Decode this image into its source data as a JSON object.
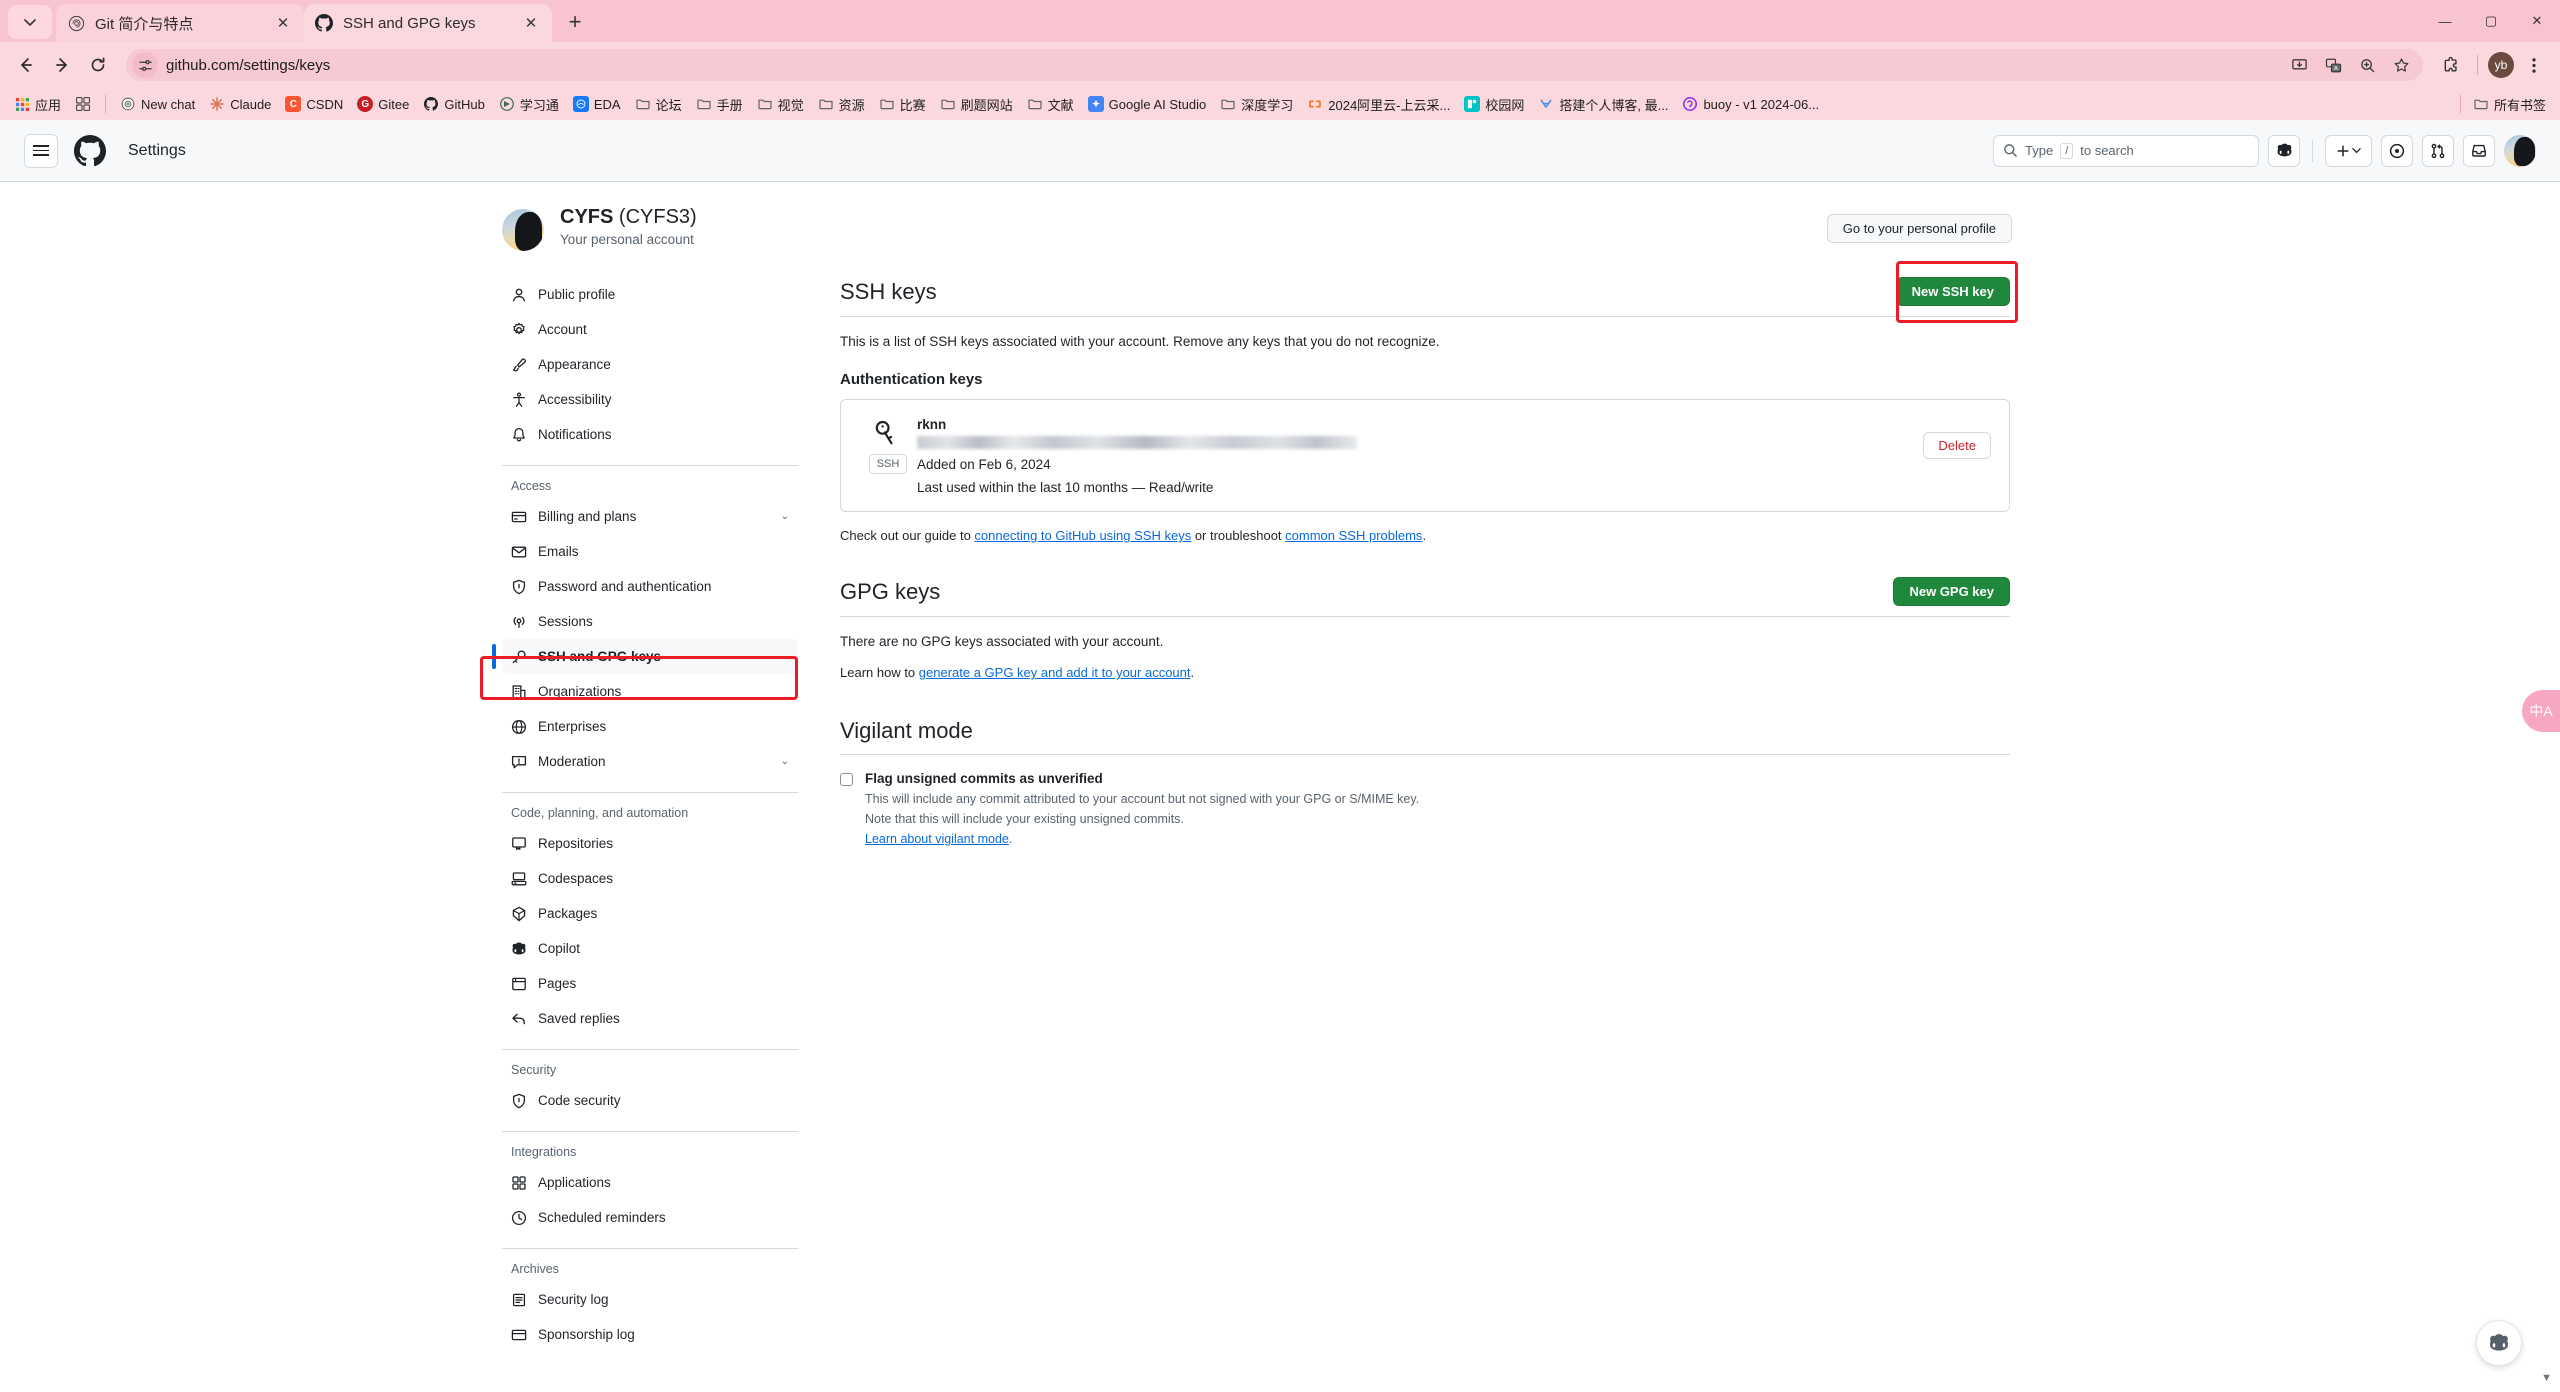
{
  "browser": {
    "tabs": [
      {
        "title": "Git 简介与特点",
        "favicon": "openai-icon",
        "active": false
      },
      {
        "title": "SSH and GPG keys",
        "favicon": "github-icon",
        "active": true
      }
    ],
    "new_tab_label": "+",
    "tab_list_icon": "chevron-down-icon",
    "window_controls": {
      "minimize": "—",
      "maximize": "▢",
      "close": "✕"
    },
    "nav": {
      "back": "←",
      "forward": "→",
      "reload": "⟳"
    },
    "omnibox": {
      "url": "github.com/settings/keys",
      "url_host": "github.com",
      "url_path": "/settings/keys",
      "site_icon": "site-settings-icon"
    },
    "toolbar_icons": [
      "install-app-icon",
      "translate-icon",
      "zoom-icon",
      "bookmark-star-icon",
      "extensions-icon"
    ],
    "profile_chip": "yb",
    "menu_icon": "kebab-menu-icon",
    "bookmarks": [
      {
        "label": "应用",
        "icon": "apps-grid-icon",
        "color": "#ffffff"
      },
      {
        "label": "",
        "icon": "bookmark-group-icon",
        "color": "#5f6368"
      },
      {
        "label": "New chat",
        "icon": "openai-icon",
        "color": "#ffffff"
      },
      {
        "label": "Claude",
        "icon": "claude-icon",
        "color": "#d97757"
      },
      {
        "label": "CSDN",
        "icon": "csdn-icon",
        "color": "#fc5531"
      },
      {
        "label": "Gitee",
        "icon": "gitee-icon",
        "color": "#c71d23"
      },
      {
        "label": "GitHub",
        "icon": "github-icon",
        "color": "#1f2328"
      },
      {
        "label": "学习通",
        "icon": "chaoxing-icon",
        "color": "#4a7a4a"
      },
      {
        "label": "EDA",
        "icon": "eda-icon",
        "color": "#1677ff"
      },
      {
        "label": "论坛",
        "icon": "folder-icon",
        "color": "#5f6368"
      },
      {
        "label": "手册",
        "icon": "folder-icon",
        "color": "#5f6368"
      },
      {
        "label": "视觉",
        "icon": "folder-icon",
        "color": "#5f6368"
      },
      {
        "label": "资源",
        "icon": "folder-icon",
        "color": "#5f6368"
      },
      {
        "label": "比赛",
        "icon": "folder-icon",
        "color": "#5f6368"
      },
      {
        "label": "刷题网站",
        "icon": "folder-icon",
        "color": "#5f6368"
      },
      {
        "label": "文献",
        "icon": "folder-icon",
        "color": "#5f6368"
      },
      {
        "label": "Google AI Studio",
        "icon": "google-ai-icon",
        "color": "#4285f4"
      },
      {
        "label": "深度学习",
        "icon": "folder-icon",
        "color": "#5f6368"
      },
      {
        "label": "2024阿里云-上云采...",
        "icon": "aliyun-icon",
        "color": "#ff6a00"
      },
      {
        "label": "校园网",
        "icon": "campus-net-icon",
        "color": "#00c2c7"
      },
      {
        "label": "搭建个人博客, 最...",
        "icon": "blog-icon",
        "color": "#4a90e2"
      },
      {
        "label": "buoy - v1 2024-06...",
        "icon": "buoy-icon",
        "color": "#8b2fe0"
      }
    ],
    "all_bookmarks": {
      "label": "所有书签",
      "icon": "folder-icon"
    }
  },
  "github": {
    "header": {
      "menu_icon": "hamburger-icon",
      "logo_icon": "github-mark-icon",
      "title": "Settings",
      "search_placeholder": "Type",
      "search_key": "/",
      "search_suffix": "to search",
      "copilot_icon": "copilot-icon",
      "create_new_icon": "plus-icon",
      "create_new_caret": "chevron-down-icon",
      "issues_icon": "issue-opened-icon",
      "pull_requests_icon": "git-pull-request-icon",
      "notifications_icon": "inbox-icon",
      "avatar": "user-avatar"
    },
    "profile": {
      "name": "CYFS",
      "handle": "(CYFS3)",
      "subtitle": "Your personal account",
      "goto_profile_label": "Go to your personal profile"
    },
    "sidebar": {
      "groups": [
        {
          "title": null,
          "items": [
            {
              "label": "Public profile",
              "icon": "person-icon",
              "chevron": false
            },
            {
              "label": "Account",
              "icon": "gear-icon",
              "chevron": false
            },
            {
              "label": "Appearance",
              "icon": "paintbrush-icon",
              "chevron": false
            },
            {
              "label": "Accessibility",
              "icon": "accessibility-icon",
              "chevron": false
            },
            {
              "label": "Notifications",
              "icon": "bell-icon",
              "chevron": false
            }
          ]
        },
        {
          "title": "Access",
          "items": [
            {
              "label": "Billing and plans",
              "icon": "credit-card-icon",
              "chevron": true
            },
            {
              "label": "Emails",
              "icon": "mail-icon",
              "chevron": false
            },
            {
              "label": "Password and authentication",
              "icon": "shield-check-icon",
              "chevron": false
            },
            {
              "label": "Sessions",
              "icon": "broadcast-icon",
              "chevron": false
            },
            {
              "label": "SSH and GPG keys",
              "icon": "key-icon",
              "chevron": false,
              "selected": true
            },
            {
              "label": "Organizations",
              "icon": "organization-icon",
              "chevron": false
            },
            {
              "label": "Enterprises",
              "icon": "globe-icon",
              "chevron": false
            },
            {
              "label": "Moderation",
              "icon": "report-icon",
              "chevron": true
            }
          ]
        },
        {
          "title": "Code, planning, and automation",
          "items": [
            {
              "label": "Repositories",
              "icon": "repo-icon",
              "chevron": false
            },
            {
              "label": "Codespaces",
              "icon": "codespaces-icon",
              "chevron": false
            },
            {
              "label": "Packages",
              "icon": "package-icon",
              "chevron": false
            },
            {
              "label": "Copilot",
              "icon": "copilot-icon",
              "chevron": false
            },
            {
              "label": "Pages",
              "icon": "browser-icon",
              "chevron": false
            },
            {
              "label": "Saved replies",
              "icon": "reply-icon",
              "chevron": false
            }
          ]
        },
        {
          "title": "Security",
          "items": [
            {
              "label": "Code security",
              "icon": "shield-check-icon",
              "chevron": false
            }
          ]
        },
        {
          "title": "Integrations",
          "items": [
            {
              "label": "Applications",
              "icon": "apps-icon",
              "chevron": false
            },
            {
              "label": "Scheduled reminders",
              "icon": "clock-icon",
              "chevron": false
            }
          ]
        },
        {
          "title": "Archives",
          "items": [
            {
              "label": "Security log",
              "icon": "log-icon",
              "chevron": false
            },
            {
              "label": "Sponsorship log",
              "icon": "credit-card-icon",
              "chevron": false
            }
          ]
        }
      ]
    },
    "ssh_section": {
      "title": "SSH keys",
      "new_button": "New SSH key",
      "description": "This is a list of SSH keys associated with your account. Remove any keys that you do not recognize.",
      "auth_keys_heading": "Authentication keys",
      "keys": [
        {
          "name": "rknn",
          "badge": "SSH",
          "icon": "key-icon",
          "fingerprint_redacted": true,
          "added": "Added on Feb 6, 2024",
          "last_used": "Last used within the last 10 months — Read/write",
          "delete_label": "Delete"
        }
      ],
      "guide_prefix": "Check out our guide to ",
      "guide_link1": "connecting to GitHub using SSH keys",
      "guide_middle": " or troubleshoot ",
      "guide_link2": "common SSH problems",
      "guide_suffix": "."
    },
    "gpg_section": {
      "title": "GPG keys",
      "new_button": "New GPG key",
      "empty_text": "There are no GPG keys associated with your account.",
      "learn_prefix": "Learn how to ",
      "learn_link": "generate a GPG key and add it to your account",
      "learn_suffix": "."
    },
    "vigilant_section": {
      "title": "Vigilant mode",
      "checkbox_checked": false,
      "checkbox_label": "Flag unsigned commits as unverified",
      "desc_line1": "This will include any commit attributed to your account but not signed with your GPG or S/MIME key.",
      "desc_line2": "Note that this will include your existing unsigned commits.",
      "learn_link": "Learn about vigilant mode",
      "learn_suffix": "."
    },
    "widgets": {
      "translate_label": "中A",
      "copilot_fab_icon": "copilot-icon"
    },
    "highlight_color": "#ec1c24"
  }
}
